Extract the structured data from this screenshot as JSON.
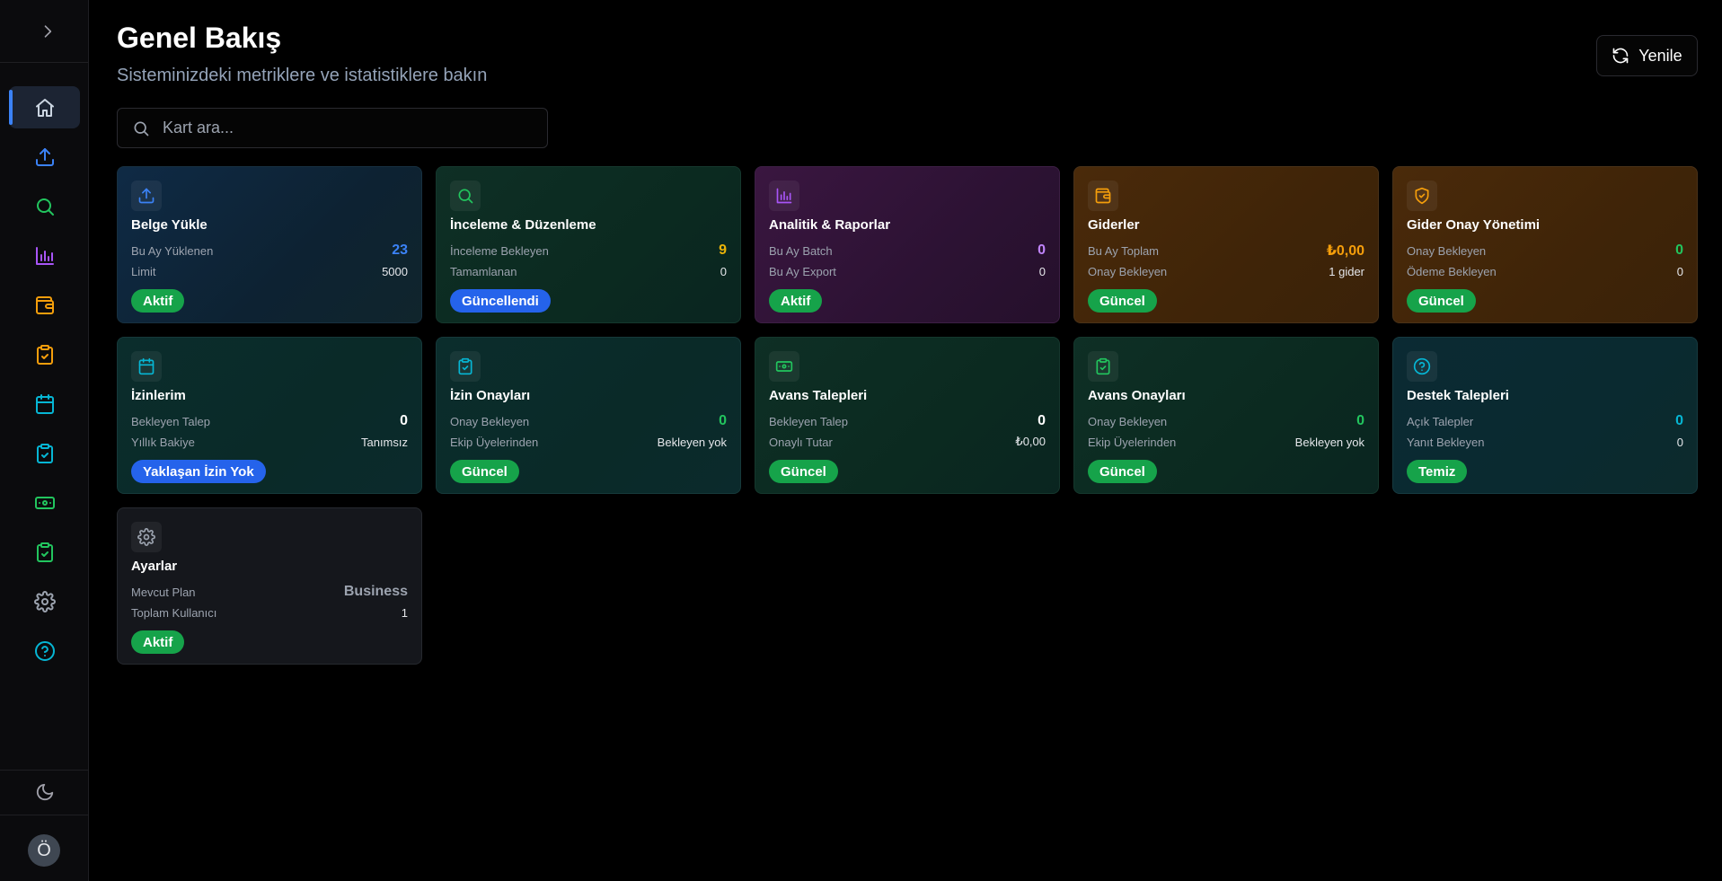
{
  "sidebar": {
    "toggle_icon": "chevron-right-icon",
    "items": [
      {
        "id": "home",
        "icon": "home-icon",
        "color": "#cbd5e1",
        "active": true
      },
      {
        "id": "upload",
        "icon": "upload-icon",
        "color": "#3b82f6"
      },
      {
        "id": "search",
        "icon": "search-icon",
        "color": "#22c55e"
      },
      {
        "id": "analytics",
        "icon": "bar-chart-icon",
        "color": "#a855f7"
      },
      {
        "id": "expenses",
        "icon": "wallet-icon",
        "color": "#f59e0b"
      },
      {
        "id": "expense-approvals",
        "icon": "clipboard-check-icon",
        "color": "#f59e0b"
      },
      {
        "id": "leaves",
        "icon": "calendar-icon",
        "color": "#06b6d4"
      },
      {
        "id": "leave-approvals",
        "icon": "clipboard-check-icon",
        "color": "#06b6d4"
      },
      {
        "id": "advances",
        "icon": "banknote-icon",
        "color": "#22c55e"
      },
      {
        "id": "advance-approvals",
        "icon": "clipboard-check-icon",
        "color": "#22c55e"
      },
      {
        "id": "settings",
        "icon": "gear-icon",
        "color": "#9ca3af"
      },
      {
        "id": "support",
        "icon": "help-circle-icon",
        "color": "#06b6d4"
      }
    ],
    "theme_icon": "moon-icon",
    "avatar_letter": "Ö"
  },
  "header": {
    "title": "Genel Bakış",
    "subtitle": "Sisteminizdeki metriklere ve istatistiklere bakın",
    "refresh_label": "Yenile"
  },
  "search": {
    "placeholder": "Kart ara..."
  },
  "cards": [
    {
      "id": "upload",
      "title": "Belge Yükle",
      "icon": "upload-icon",
      "icon_color": "#3b82f6",
      "theme": "bg-blue",
      "row1_label": "Bu Ay Yüklenen",
      "row1_value": "23",
      "row1_color": "#3b82f6",
      "row2_label": "Limit",
      "row2_value": "5000",
      "badge": "Aktif",
      "badge_color": "green"
    },
    {
      "id": "review",
      "title": "İnceleme & Düzenleme",
      "icon": "search-icon",
      "icon_color": "#22c55e",
      "theme": "bg-green",
      "row1_label": "İnceleme Bekleyen",
      "row1_value": "9",
      "row1_color": "#eab308",
      "row2_label": "Tamamlanan",
      "row2_value": "0",
      "badge": "Güncellendi",
      "badge_color": "blue"
    },
    {
      "id": "analytics",
      "title": "Analitik & Raporlar",
      "icon": "bar-chart-icon",
      "icon_color": "#a855f7",
      "theme": "bg-purple",
      "row1_label": "Bu Ay Batch",
      "row1_value": "0",
      "row1_color": "#c084fc",
      "row2_label": "Bu Ay Export",
      "row2_value": "0",
      "badge": "Aktif",
      "badge_color": "green"
    },
    {
      "id": "expenses",
      "title": "Giderler",
      "icon": "wallet-icon",
      "icon_color": "#f59e0b",
      "theme": "bg-orange",
      "row1_label": "Bu Ay Toplam",
      "row1_value": "₺0,00",
      "row1_color": "#f59e0b",
      "row2_label": "Onay Bekleyen",
      "row2_value": "1 gider",
      "badge": "Güncel",
      "badge_color": "green"
    },
    {
      "id": "expense-approval",
      "title": "Gider Onay Yönetimi",
      "icon": "shield-check-icon",
      "icon_color": "#f59e0b",
      "theme": "bg-orange",
      "row1_label": "Onay Bekleyen",
      "row1_value": "0",
      "row1_color": "#22c55e",
      "row2_label": "Ödeme Bekleyen",
      "row2_value": "0",
      "badge": "Güncel",
      "badge_color": "green"
    },
    {
      "id": "leaves",
      "title": "İzinlerim",
      "icon": "calendar-icon",
      "icon_color": "#06b6d4",
      "theme": "bg-teal",
      "row1_label": "Bekleyen Talep",
      "row1_value": "0",
      "row1_color": "#ffffff",
      "row2_label": "Yıllık Bakiye",
      "row2_value": "Tanımsız",
      "badge": "Yaklaşan İzin Yok",
      "badge_color": "blue"
    },
    {
      "id": "leave-approvals",
      "title": "İzin Onayları",
      "icon": "clipboard-check-icon",
      "icon_color": "#06b6d4",
      "theme": "bg-teal",
      "row1_label": "Onay Bekleyen",
      "row1_value": "0",
      "row1_color": "#22c55e",
      "row2_label": "Ekip Üyelerinden",
      "row2_value": "Bekleyen yok",
      "badge": "Güncel",
      "badge_color": "green"
    },
    {
      "id": "advances",
      "title": "Avans Talepleri",
      "icon": "banknote-icon",
      "icon_color": "#22c55e",
      "theme": "bg-green",
      "row1_label": "Bekleyen Talep",
      "row1_value": "0",
      "row1_color": "#ffffff",
      "row2_label": "Onaylı Tutar",
      "row2_value": "₺0,00",
      "badge": "Güncel",
      "badge_color": "green"
    },
    {
      "id": "advance-approvals",
      "title": "Avans Onayları",
      "icon": "clipboard-check-icon",
      "icon_color": "#22c55e",
      "theme": "bg-green",
      "row1_label": "Onay Bekleyen",
      "row1_value": "0",
      "row1_color": "#22c55e",
      "row2_label": "Ekip Üyelerinden",
      "row2_value": "Bekleyen yok",
      "badge": "Güncel",
      "badge_color": "green"
    },
    {
      "id": "support",
      "title": "Destek Talepleri",
      "icon": "help-circle-icon",
      "icon_color": "#06b6d4",
      "theme": "bg-teal2",
      "row1_label": "Açık Talepler",
      "row1_value": "0",
      "row1_color": "#06b6d4",
      "row2_label": "Yanıt Bekleyen",
      "row2_value": "0",
      "badge": "Temiz",
      "badge_color": "green"
    },
    {
      "id": "settings",
      "title": "Ayarlar",
      "icon": "gear-icon",
      "icon_color": "#9ca3af",
      "theme": "bg-gray",
      "row1_label": "Mevcut Plan",
      "row1_value": "Business",
      "row1_color": "#9ca3af",
      "row2_label": "Toplam Kullanıcı",
      "row2_value": "1",
      "badge": "Aktif",
      "badge_color": "green"
    }
  ]
}
